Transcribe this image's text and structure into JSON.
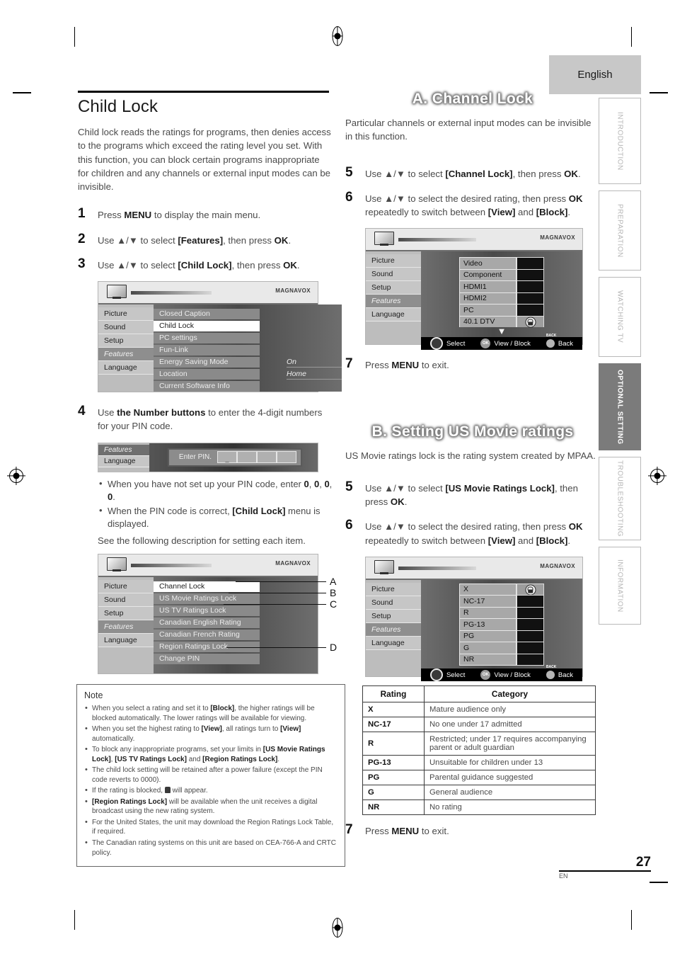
{
  "header": {
    "language_tab": "English"
  },
  "sidebar": {
    "tabs": [
      {
        "label": "INTRODUCTION",
        "active": false
      },
      {
        "label": "PREPARATION",
        "active": false
      },
      {
        "label": "WATCHING TV",
        "active": false
      },
      {
        "label": "OPTIONAL SETTING",
        "active": true
      },
      {
        "label": "TROUBLESHOOTING",
        "active": false
      },
      {
        "label": "INFORMATION",
        "active": false
      }
    ]
  },
  "footer": {
    "page_number": "27",
    "page_lang": "EN"
  },
  "left_column": {
    "title": "Child Lock",
    "intro": "Child lock reads the ratings for programs, then denies access to the programs which exceed the rating level you set. With this function, you can block certain programs inappropriate for children and any channels or external input modes can be invisible.",
    "steps": [
      {
        "num": "1",
        "text_html": "Press <b class=\"k\">MENU</b> to display the main menu."
      },
      {
        "num": "2",
        "text_html": "Use ▲/▼ to select <b class=\"k\">[Features]</b>, then press <b class=\"k\">OK</b>."
      },
      {
        "num": "3",
        "text_html": "Use ▲/▼ to select <b class=\"k\">[Child Lock]</b>, then press <b class=\"k\">OK</b>."
      },
      {
        "num": "4",
        "text_html": "Use <b class=\"k\">the Number buttons</b> to enter the 4-digit numbers for your PIN code."
      }
    ],
    "bullets_after_step4": [
      "When you have not set up your PIN code, enter <b class=\"k\">0</b>, <b class=\"k\">0</b>, <b class=\"k\">0</b>, <b class=\"k\">0</b>.",
      "When the PIN code is correct, <b class=\"k\">[Child Lock]</b> menu is displayed."
    ],
    "see_following": "See the following description for setting each item.",
    "menu_features": {
      "logo": "MAGNAVOX",
      "left_items": [
        "Picture",
        "Sound",
        "Setup",
        "Features",
        "Language"
      ],
      "selected_left": "Features",
      "rows": [
        {
          "label": "Closed Caption",
          "value": "",
          "highlight": false
        },
        {
          "label": "Child Lock",
          "value": "",
          "highlight": true
        },
        {
          "label": "PC settings",
          "value": "",
          "highlight": false
        },
        {
          "label": "Fun-Link",
          "value": "",
          "highlight": false
        },
        {
          "label": "Energy Saving Mode",
          "value": "On",
          "highlight": false
        },
        {
          "label": "Location",
          "value": "Home",
          "highlight": false
        },
        {
          "label": "Current Software Info",
          "value": "",
          "highlight": false
        }
      ]
    },
    "menu_pin": {
      "left_items": [
        "Features",
        "Language"
      ],
      "selected_left": "Features",
      "prompt": "Enter PIN.",
      "cells": [
        "_",
        "",
        "",
        ""
      ]
    },
    "menu_childlock": {
      "logo": "MAGNAVOX",
      "left_items": [
        "Picture",
        "Sound",
        "Setup",
        "Features",
        "Language"
      ],
      "selected_left": "Features",
      "rows": [
        {
          "label": "Channel Lock",
          "highlight": true,
          "callout": "A"
        },
        {
          "label": "US Movie Ratings Lock",
          "highlight": false,
          "callout": "B"
        },
        {
          "label": "US TV Ratings Lock",
          "highlight": false,
          "callout": "C"
        },
        {
          "label": "Canadian English Rating",
          "highlight": false,
          "callout": ""
        },
        {
          "label": "Canadian French Rating",
          "highlight": false,
          "callout": ""
        },
        {
          "label": "Region Ratings Lock",
          "highlight": false,
          "callout": ""
        },
        {
          "label": "Change PIN",
          "highlight": false,
          "callout": "D"
        }
      ]
    },
    "note": {
      "title": "Note",
      "items": [
        "When you select a rating and set it to <b>[Block]</b>, the higher ratings will be blocked automatically. The lower ratings will be available for viewing.",
        "When you set the highest rating to <b>[View]</b>, all ratings turn to <b>[View]</b> automatically.",
        "To block any inappropriate programs, set your limits in <b>[US Movie Ratings Lock]</b>, <b>[US TV Ratings Lock]</b> and <b>[Region Ratings Lock]</b>.",
        "The child lock setting will be retained after a power failure (except the PIN code reverts to 0000).",
        "If the rating is blocked, <span class=\"inline-lock\"></span> will appear.",
        "<b>[Region Ratings Lock]</b> will be available when the unit receives a digital broadcast using the new rating system.",
        "For the United States, the unit may download the Region Ratings Lock Table, if required.",
        "The Canadian rating systems on this unit are based on CEA-766-A and CRTC policy."
      ]
    }
  },
  "right_column": {
    "section_a": {
      "banner": "A. Channel Lock",
      "intro": "Particular channels or external input modes can be invisible in this function.",
      "steps": [
        {
          "num": "5",
          "text_html": "Use ▲/▼ to select <b class=\"k\">[Channel Lock]</b>, then press <b class=\"k\">OK</b>."
        },
        {
          "num": "6",
          "text_html": "Use ▲/▼ to select the desired rating, then press <b class=\"k\">OK</b> repeatedly to switch between <b class=\"k\">[View]</b> and <b class=\"k\">[Block]</b>."
        }
      ],
      "menu": {
        "logo": "MAGNAVOX",
        "left_items": [
          "Picture",
          "Sound",
          "Setup",
          "Features",
          "Language"
        ],
        "selected_left": "Features",
        "rows": [
          {
            "label": "Video",
            "locked": false
          },
          {
            "label": "Component",
            "locked": false
          },
          {
            "label": "HDMI1",
            "locked": false
          },
          {
            "label": "HDMI2",
            "locked": false
          },
          {
            "label": "PC",
            "locked": false
          },
          {
            "label": "40.1 DTV",
            "locked": true
          }
        ],
        "more_indicator": "▼",
        "footer": [
          {
            "icon": "nav-ring-icon",
            "label": "Select"
          },
          {
            "icon": "ok-button-icon",
            "label": "View / Block"
          },
          {
            "icon": "back-button-icon",
            "label": "Back",
            "badge": "BACK"
          }
        ]
      },
      "step7": {
        "num": "7",
        "text_html": "Press <b class=\"k\">MENU</b> to exit."
      }
    },
    "section_b": {
      "banner": "B. Setting US Movie ratings",
      "intro": "US Movie ratings lock is the rating system created by MPAA.",
      "steps": [
        {
          "num": "5",
          "text_html": "Use ▲/▼ to select <b class=\"k\">[US Movie Ratings Lock]</b>, then press <b class=\"k\">OK</b>."
        },
        {
          "num": "6",
          "text_html": "Use ▲/▼ to select the desired rating, then press <b class=\"k\">OK</b> repeatedly to switch between <b class=\"k\">[View]</b> and <b class=\"k\">[Block]</b>."
        }
      ],
      "menu": {
        "logo": "MAGNAVOX",
        "left_items": [
          "Picture",
          "Sound",
          "Setup",
          "Features",
          "Language"
        ],
        "selected_left": "Features",
        "rows": [
          {
            "label": "X",
            "locked": true
          },
          {
            "label": "NC-17",
            "locked": false
          },
          {
            "label": "R",
            "locked": false
          },
          {
            "label": "PG-13",
            "locked": false
          },
          {
            "label": "PG",
            "locked": false
          },
          {
            "label": "G",
            "locked": false
          },
          {
            "label": "NR",
            "locked": false
          }
        ],
        "footer": [
          {
            "icon": "nav-ring-icon",
            "label": "Select"
          },
          {
            "icon": "ok-button-icon",
            "label": "View / Block"
          },
          {
            "icon": "back-button-icon",
            "label": "Back",
            "badge": "BACK"
          }
        ]
      },
      "table": {
        "headers": [
          "Rating",
          "Category"
        ],
        "rows": [
          {
            "rating": "X",
            "category": "Mature audience only"
          },
          {
            "rating": "NC-17",
            "category": "No one under 17 admitted"
          },
          {
            "rating": "R",
            "category": "Restricted; under 17 requires accompanying parent or adult guardian"
          },
          {
            "rating": "PG-13",
            "category": "Unsuitable for children under 13"
          },
          {
            "rating": "PG",
            "category": "Parental guidance suggested"
          },
          {
            "rating": "G",
            "category": "General audience"
          },
          {
            "rating": "NR",
            "category": "No rating"
          }
        ]
      },
      "step7": {
        "num": "7",
        "text_html": "Press <b class=\"k\">MENU</b> to exit."
      }
    }
  }
}
